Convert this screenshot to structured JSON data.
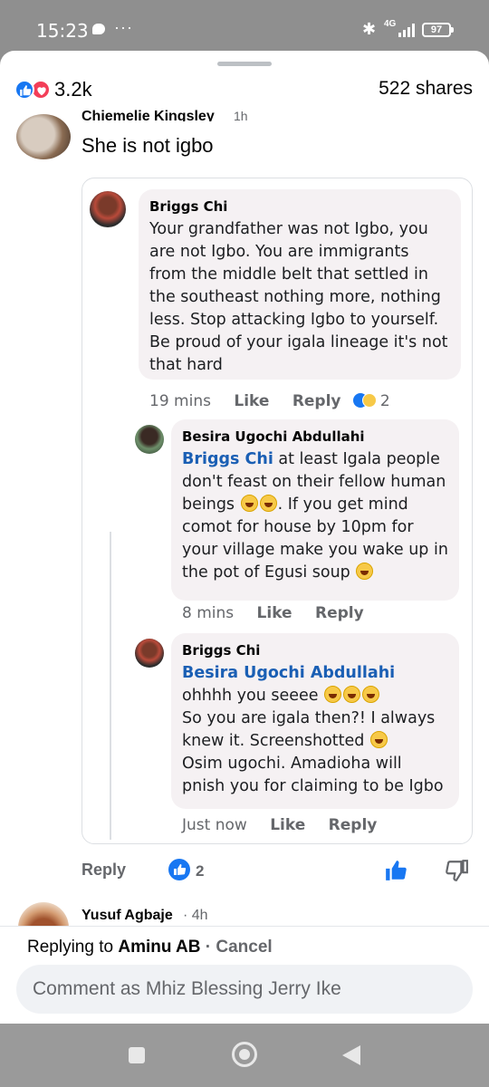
{
  "status_bar": {
    "time": "15:23",
    "network": "4G",
    "battery": "97"
  },
  "post_stats": {
    "reactions_count": "3.2k",
    "shares": "522 shares"
  },
  "top_comment": {
    "author": "Chiemelie Kingsley",
    "time": "1h",
    "text": "She is not igbo"
  },
  "replies": [
    {
      "author": "Briggs Chi",
      "text": "Your grandfather was not Igbo, you are not Igbo. You are immigrants from the middle belt that settled in the southeast nothing more, nothing less. Stop attacking Igbo to yourself. Be proud of your igala lineage it's not that hard",
      "time": "19 mins",
      "like_label": "Like",
      "reply_label": "Reply",
      "reaction_count": "2"
    },
    {
      "author": "Besira Ugochi Abdullahi",
      "mention": "Briggs Chi",
      "text_a": " at least Igala people don't feast on their fellow human beings",
      "text_b": ". If you get mind comot for house by 10pm for your village make you wake up in the pot of Egusi soup",
      "time": "8 mins",
      "like_label": "Like",
      "reply_label": "Reply"
    },
    {
      "author": "Briggs Chi",
      "mention": "Besira Ugochi Abdullahi",
      "text_a": " ohhhh you seeee",
      "text_b": "So you are igala then?! I always knew it. Screenshotted",
      "text_c": "Osim ugochi. Amadioha will pnish you for claiming to be Igbo",
      "time": "Just now",
      "like_label": "Like",
      "reply_label": "Reply"
    }
  ],
  "comment_actions": {
    "reply_label": "Reply",
    "like_count": "2"
  },
  "next_comment": {
    "author": "Yusuf Agbaje",
    "time": "· 4h"
  },
  "compose": {
    "replying_prefix": "Replying to ",
    "replying_to": "Aminu AB",
    "cancel": " · Cancel",
    "placeholder": "Comment as Mhiz Blessing Jerry Ike"
  },
  "colors": {
    "facebook_blue": "#1877f2",
    "love_red": "#f33e58",
    "mention_blue": "#1a5fb4"
  }
}
